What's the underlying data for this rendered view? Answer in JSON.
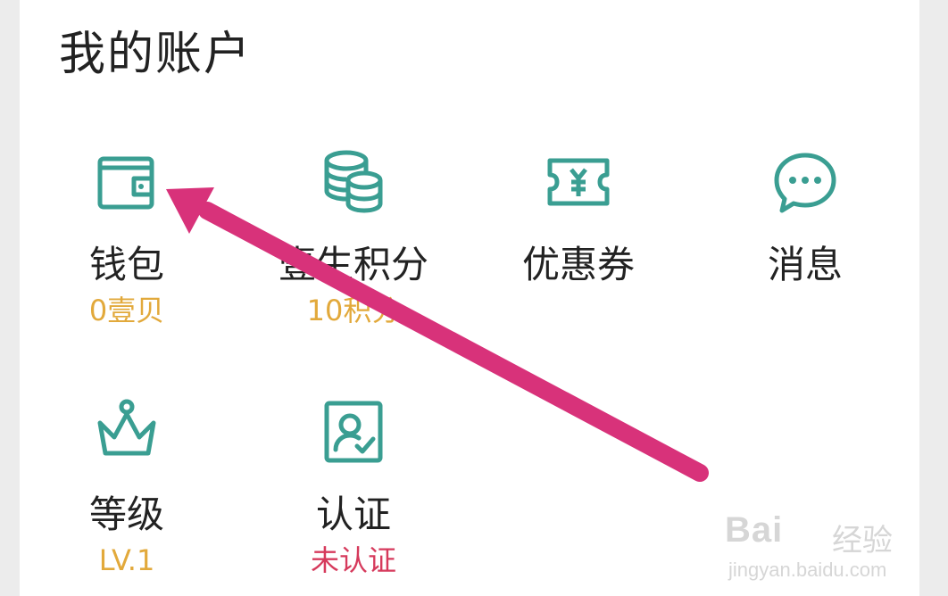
{
  "section": {
    "title": "我的账户"
  },
  "items": [
    {
      "label": "钱包",
      "sub": "0壹贝",
      "icon": "wallet-icon"
    },
    {
      "label": "壹生积分",
      "sub": "10积分",
      "icon": "coins-icon"
    },
    {
      "label": "优惠券",
      "sub": "",
      "icon": "coupon-icon"
    },
    {
      "label": "消息",
      "sub": "",
      "icon": "message-icon"
    },
    {
      "label": "等级",
      "sub": "LV.1",
      "icon": "crown-icon"
    },
    {
      "label": "认证",
      "sub": "未认证",
      "icon": "id-verify-icon"
    }
  ],
  "colors": {
    "icon": "#3a9e92",
    "sub_gold": "#e2a93b",
    "sub_red": "#d63a5c",
    "arrow": "#d8327a"
  },
  "watermark": {
    "brand": "Bai",
    "brand2": "经验",
    "url": "jingyan.baidu.com"
  }
}
